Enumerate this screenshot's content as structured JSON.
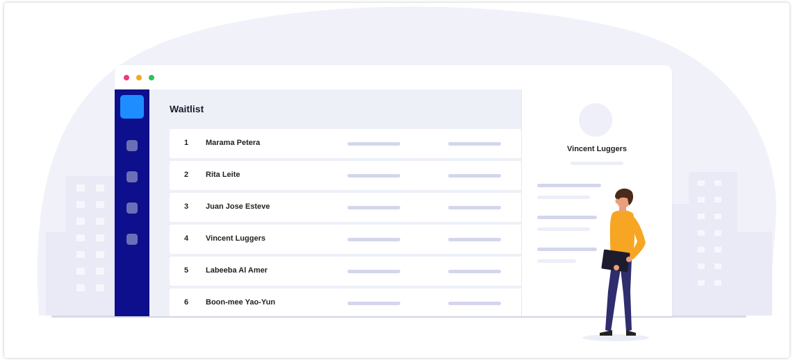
{
  "colors": {
    "sidebar": "#0d0f8c",
    "sidebar_active": "#1e8dff",
    "background_blob": "#f1f2f9",
    "placeholder": "#d3d6ec"
  },
  "window": {
    "controls": [
      "close",
      "minimize",
      "maximize"
    ]
  },
  "waitlist": {
    "title": "Waitlist",
    "rows": [
      {
        "num": "1",
        "name": "Marama Petera"
      },
      {
        "num": "2",
        "name": "Rita Leite"
      },
      {
        "num": "3",
        "name": "Juan Jose Esteve"
      },
      {
        "num": "4",
        "name": "Vincent Luggers"
      },
      {
        "num": "5",
        "name": "Labeeba Al Amer"
      },
      {
        "num": "6",
        "name": "Boon-mee Yao-Yun"
      }
    ]
  },
  "detail": {
    "name": "Vincent Luggers"
  },
  "icons": {
    "avatar": "avatar-placeholder-icon",
    "sidebar_items": [
      "nav-square-icon",
      "nav-square-icon",
      "nav-square-icon",
      "nav-square-icon"
    ]
  }
}
